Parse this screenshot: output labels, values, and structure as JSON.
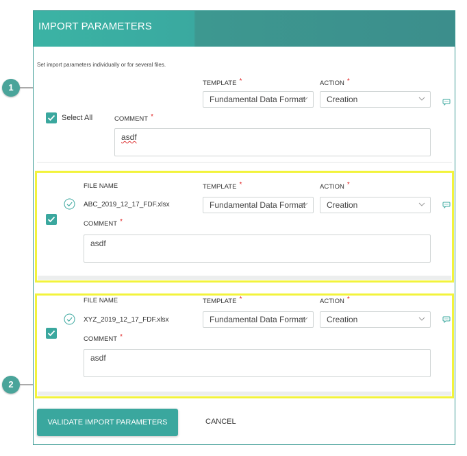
{
  "dialog": {
    "title": "IMPORT PARAMETERS",
    "subtitle": "Set import parameters individually or for several files."
  },
  "labels": {
    "template": "TEMPLATE",
    "action": "ACTION",
    "comment": "COMMENT",
    "file_name": "FILE NAME",
    "required_marker": "*"
  },
  "bulk": {
    "select_all_label": "Select All",
    "select_all_checked": true,
    "template_value": "Fundamental Data Format",
    "action_value": "Creation",
    "comment_value": "asdf"
  },
  "files": [
    {
      "checked": true,
      "file_name": "ABC_2019_12_17_FDF.xlsx",
      "template_value": "Fundamental Data Format",
      "action_value": "Creation",
      "comment_value": "asdf"
    },
    {
      "checked": true,
      "file_name": "XYZ_2019_12_17_FDF.xlsx",
      "template_value": "Fundamental Data Format",
      "action_value": "Creation",
      "comment_value": "asdf"
    }
  ],
  "footer": {
    "validate_label": "VALIDATE IMPORT PARAMETERS",
    "cancel_label": "CANCEL"
  },
  "callouts": [
    "1",
    "2"
  ],
  "colors": {
    "accent": "#3aa79e",
    "header_dark": "#3c8e8c",
    "highlight": "#f2f33c",
    "required": "#e02020"
  }
}
